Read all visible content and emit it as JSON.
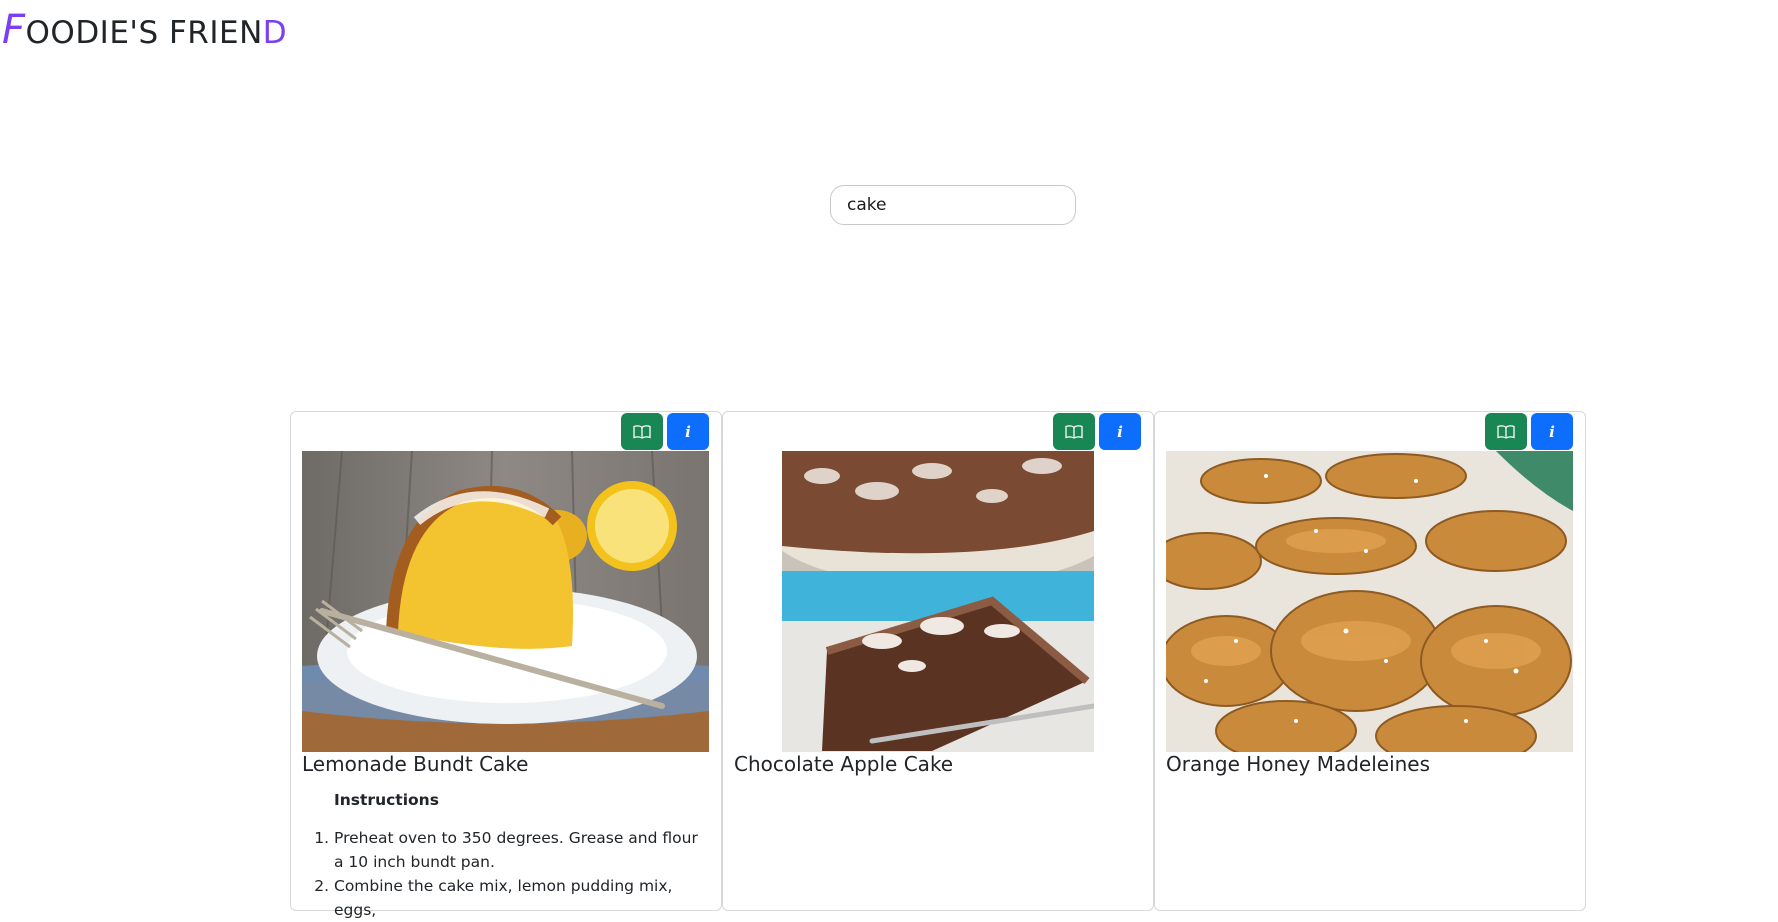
{
  "header": {
    "logo_first": "F",
    "logo_middle": "OODIE'S FRIEN",
    "logo_last": "D"
  },
  "search": {
    "value": "cake",
    "placeholder": ""
  },
  "colors": {
    "accent": "#7a3ff0",
    "button_green": "#198754",
    "button_blue": "#0d6efd"
  },
  "cards": [
    {
      "title": "Lemonade Bundt Cake",
      "image": "lemonade-bundt-cake-photo",
      "instructions_heading": "Instructions",
      "steps": [
        "Preheat oven to 350 degrees. Grease and flour a 10 inch bundt pan.",
        "Combine the cake mix, lemon pudding mix, eggs,"
      ]
    },
    {
      "title": "Chocolate Apple Cake",
      "image": "chocolate-apple-cake-photo"
    },
    {
      "title": "Orange Honey Madeleines",
      "image": "orange-honey-madeleines-photo"
    }
  ],
  "icons": {
    "recipe_button": "book-icon",
    "info_button": "info-icon"
  }
}
